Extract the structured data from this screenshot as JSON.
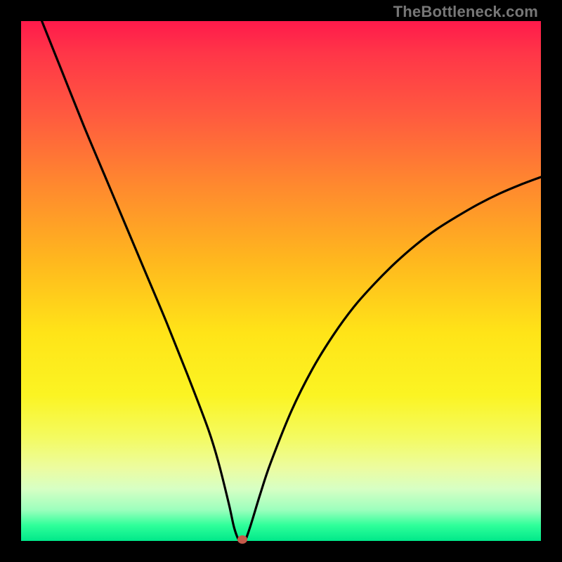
{
  "watermark": "TheBottleneck.com",
  "chart_data": {
    "type": "line",
    "title": "",
    "xlabel": "",
    "ylabel": "",
    "xlim": [
      0,
      100
    ],
    "ylim": [
      0,
      100
    ],
    "grid": false,
    "legend": false,
    "series": [
      {
        "name": "bottleneck-curve",
        "x": [
          4,
          8,
          12,
          16,
          20,
          24,
          28,
          32,
          36,
          38,
          40,
          41,
          42,
          43,
          44,
          46,
          48,
          52,
          56,
          60,
          64,
          68,
          72,
          76,
          80,
          84,
          88,
          92,
          96,
          100
        ],
        "y": [
          100,
          90,
          80,
          70.5,
          61,
          51.5,
          42,
          32,
          21.5,
          15,
          7,
          2.5,
          0,
          0,
          2.5,
          9,
          15,
          25,
          33,
          39.5,
          45,
          49.5,
          53.5,
          57,
          60,
          62.5,
          64.8,
          66.8,
          68.5,
          70
        ]
      }
    ],
    "minimum_point": {
      "x": 42.5,
      "y": 0
    },
    "gradient_stops": [
      {
        "pct": 0,
        "color": "#ff1a4b"
      },
      {
        "pct": 50,
        "color": "#ffd61c"
      },
      {
        "pct": 85,
        "color": "#f0fc80"
      },
      {
        "pct": 100,
        "color": "#00e88a"
      }
    ]
  }
}
